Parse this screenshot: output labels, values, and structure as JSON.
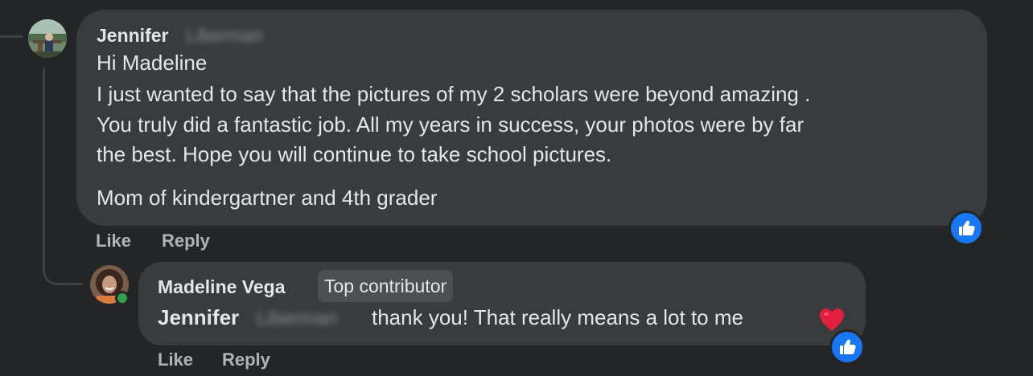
{
  "comment": {
    "author_first": "Jennifer",
    "author_last": "Liberman",
    "lines": [
      "Hi Madeline",
      "I just wanted to say that the pictures of my 2 scholars were beyond amazing .",
      "You truly did a fantastic job. All my years in success, your photos were by far",
      "the best. Hope you will continue to take school pictures.",
      "Mom of kindergartner and 4th grader"
    ],
    "actions": {
      "like": "Like",
      "reply": "Reply"
    }
  },
  "reply": {
    "author": "Madeline Vega",
    "badge": "Top contributor",
    "mention_first": "Jennifer",
    "mention_last": "Liberman",
    "text": "thank you! That really means a lot to me",
    "emoji": "heart-icon",
    "actions": {
      "like": "Like",
      "reply": "Reply"
    }
  },
  "colors": {
    "background": "#242526",
    "bubble": "#3a3b3c",
    "text": "#e4e6eb",
    "muted": "#b0b3b8",
    "like_blue": "#1877f2",
    "heart": "#e41e3f",
    "online": "#31a24c"
  }
}
